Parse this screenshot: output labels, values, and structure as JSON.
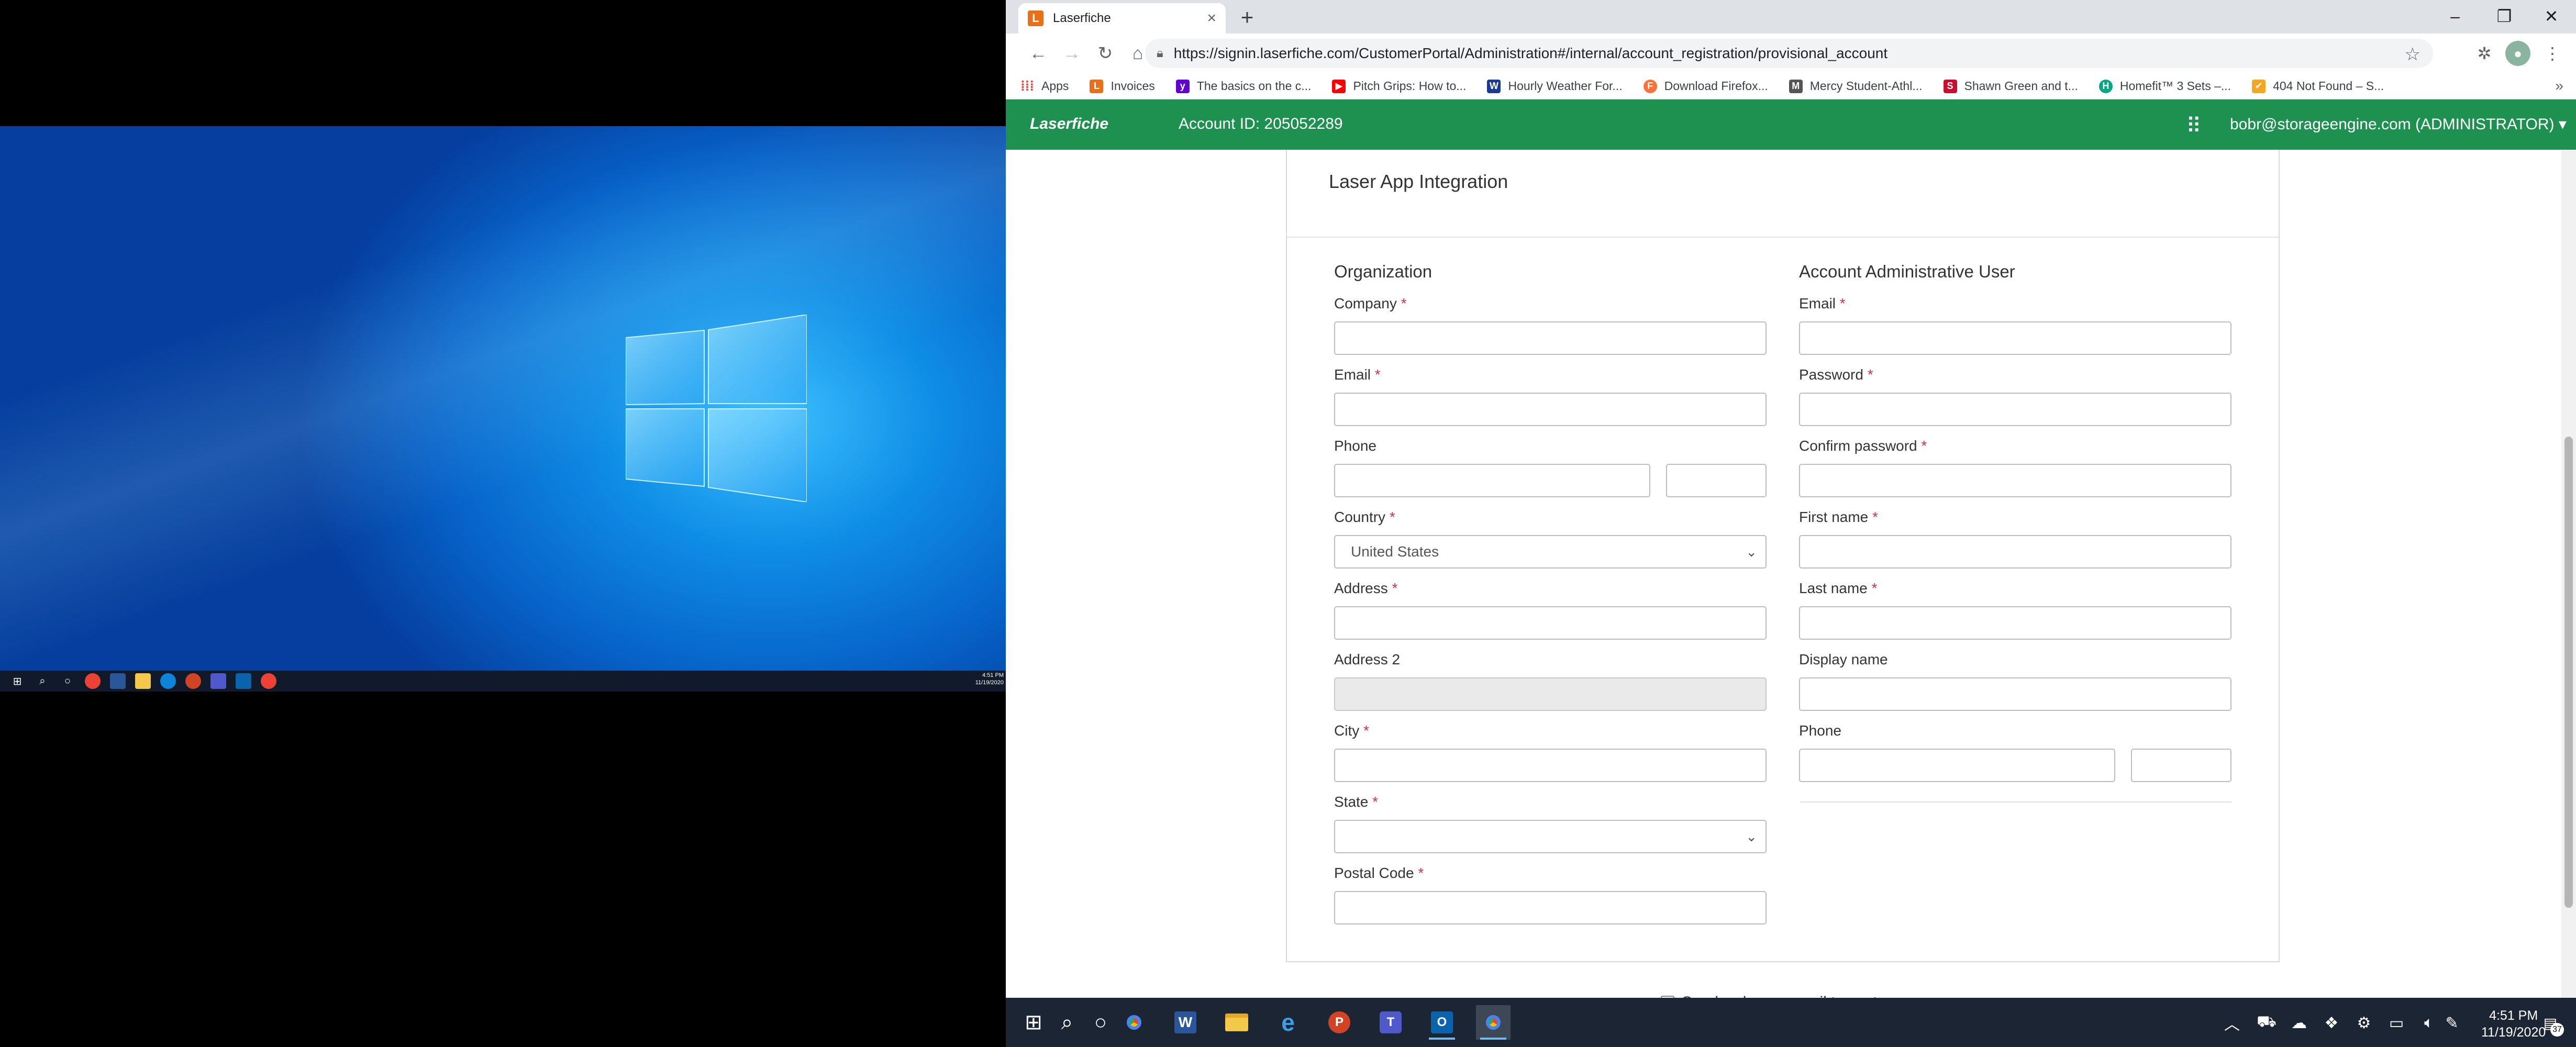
{
  "mini_desktop": {
    "clock_time": "4:51 PM",
    "clock_date": "11/19/2020"
  },
  "browser": {
    "tab_title": "Laserfiche",
    "favicon_letter": "L",
    "url": "https://signin.laserfiche.com/CustomerPortal/Administration#/internal/account_registration/provisional_account",
    "bookmarks": [
      {
        "label": "Apps",
        "icon": "apps-grid",
        "color": "#e8453c"
      },
      {
        "label": "Invoices",
        "icon": "L",
        "color": "#e8701a"
      },
      {
        "label": "The basics on the c...",
        "icon": "y!",
        "color": "#6001d2"
      },
      {
        "label": "Pitch Grips: How to...",
        "icon": "▶",
        "color": "#ff0000"
      },
      {
        "label": "Hourly Weather For...",
        "icon": "W",
        "color": "#1a3c8f"
      },
      {
        "label": "Download Firefox...",
        "icon": "F",
        "color": "#ff7139"
      },
      {
        "label": "Mercy Student-Athl...",
        "icon": "M",
        "color": "#555555"
      },
      {
        "label": "Shawn Green and t...",
        "icon": "S",
        "color": "#c8102e"
      },
      {
        "label": "Homefit™ 3 Sets –...",
        "icon": "H",
        "color": "#00a884"
      },
      {
        "label": "404 Not Found – S...",
        "icon": "✔",
        "color": "#f5a623"
      }
    ]
  },
  "header": {
    "brand": "Laserfiche",
    "account_id": "Account ID: 205052289",
    "user": "bobr@storageengine.com (ADMINISTRATOR)"
  },
  "form": {
    "title": "Laser App Integration",
    "organization": {
      "heading": "Organization",
      "company_label": "Company",
      "email_label": "Email",
      "phone_label": "Phone",
      "country_label": "Country",
      "country_value": "United States",
      "address_label": "Address",
      "address2_label": "Address 2",
      "city_label": "City",
      "state_label": "State",
      "postal_label": "Postal Code"
    },
    "admin_user": {
      "heading": "Account Administrative User",
      "email_label": "Email",
      "password_label": "Password",
      "confirm_label": "Confirm password",
      "first_name_label": "First name",
      "last_name_label": "Last name",
      "display_name_label": "Display name",
      "phone_label": "Phone"
    },
    "required_mark": "*",
    "welcome_label": "Send welcome email to customer"
  },
  "taskbar": {
    "clock_time": "4:51 PM",
    "clock_date": "11/19/2020",
    "notification_count": "37"
  },
  "colors": {
    "header_green": "#1e9150",
    "required_red": "#d9333f",
    "taskbar": "#1c2533"
  }
}
